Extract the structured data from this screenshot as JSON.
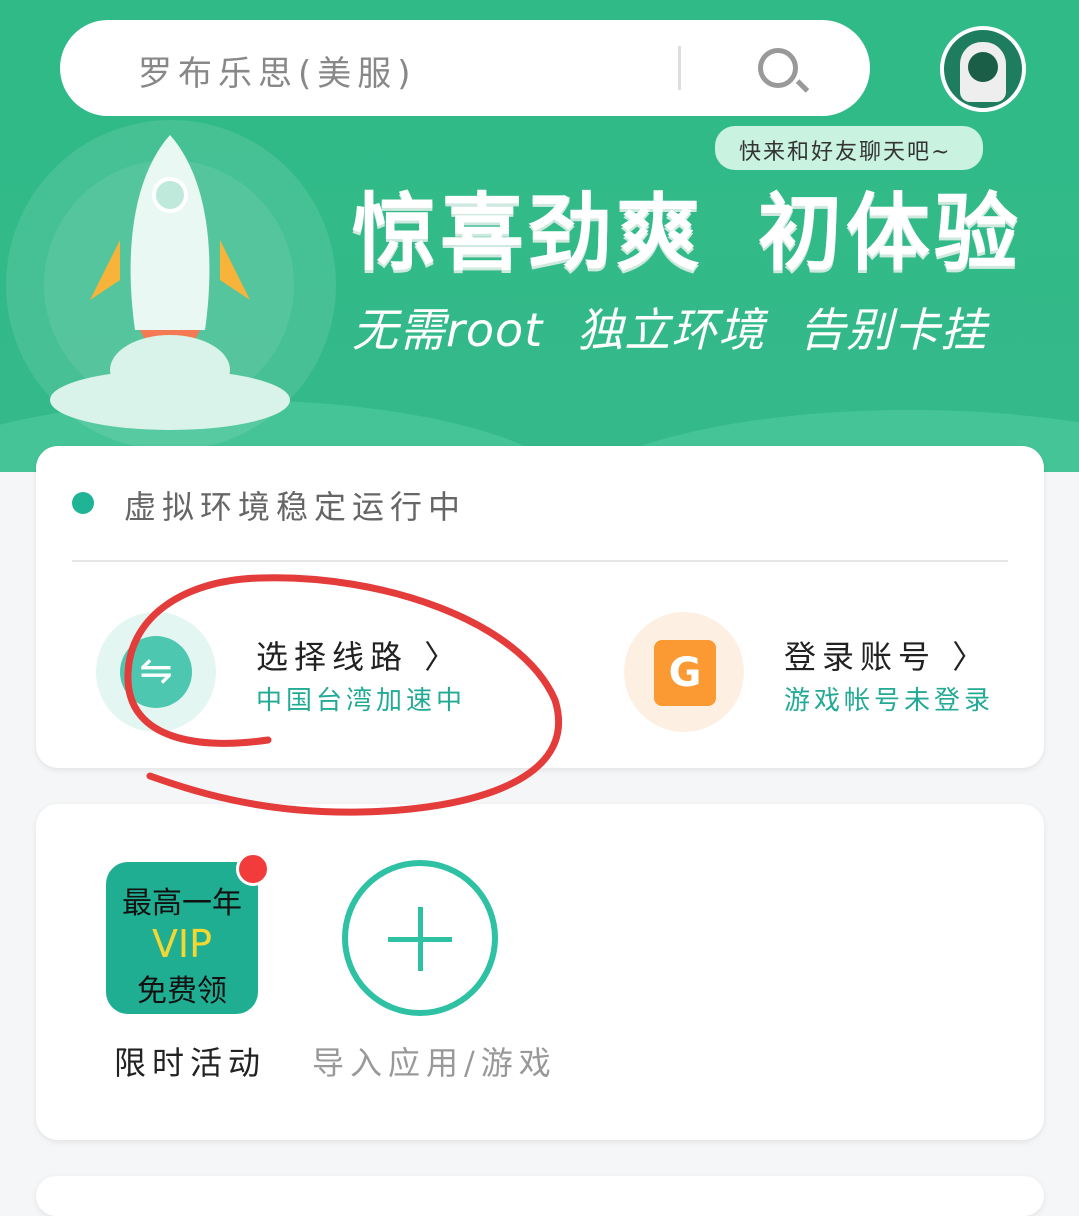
{
  "search": {
    "placeholder": "罗布乐思(美服)"
  },
  "banner": {
    "chat_bubble": "快来和好友聊天吧~",
    "headline_1": "惊喜劲爽",
    "headline_2": "初体验",
    "tagline": [
      "无需root",
      "独立环境",
      "告别卡挂"
    ]
  },
  "status": {
    "text": "虚拟环境稳定运行中",
    "color": "#1fb496"
  },
  "features": [
    {
      "title": "选择线路",
      "subtitle": "中国台湾加速中",
      "icon": "swap-icon"
    },
    {
      "title": "登录账号",
      "subtitle": "游戏帐号未登录",
      "icon": "game-g-icon"
    }
  ],
  "apps": [
    {
      "label": "限时活动",
      "tile": [
        "最高一年",
        "VIP",
        "免费领"
      ]
    },
    {
      "label": "导入应用/游戏"
    }
  ],
  "chevron": "〉"
}
